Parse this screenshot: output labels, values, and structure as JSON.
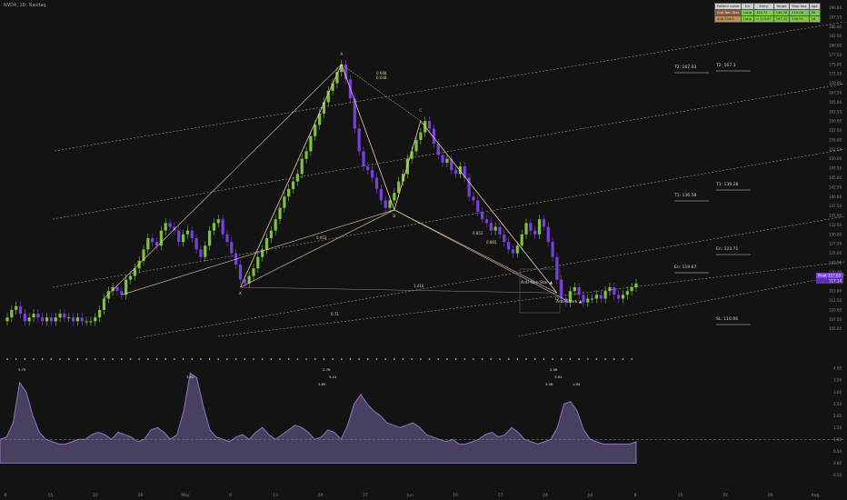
{
  "ticker": "NVDA, 1D, Nasdaq",
  "pattern_table": {
    "headers": [
      "Pattern name",
      "Dir",
      "Entry",
      "Target",
      "Stop loss",
      "Age"
    ],
    "rows": [
      {
        "name": "Anti-Nen Star",
        "dir": "Long",
        "entry": "123.71",
        "target": "139.28",
        "stop": "110.06",
        "age": "39"
      },
      {
        "name": "Anti-Shark",
        "dir": "Long",
        "entry": "< 119.67",
        "target": "167.31",
        "stop": "104.91",
        "age": "16"
      }
    ]
  },
  "price_badges": {
    "label": "Pivot",
    "value": "117.63",
    "current": "117.14"
  },
  "chart_data": {
    "type": "candlestick",
    "y_axis": {
      "min": 103.0,
      "max": 190.6
    },
    "y_ticks": [
      "190.00",
      "187.50",
      "185.00",
      "182.50",
      "180.00",
      "177.50",
      "175.00",
      "172.50",
      "170.00",
      "167.50",
      "165.00",
      "162.50",
      "160.00",
      "157.50",
      "155.00",
      "152.50",
      "150.00",
      "147.50",
      "145.00",
      "142.50",
      "140.00",
      "137.50",
      "135.00",
      "132.50",
      "130.00",
      "127.50",
      "125.00",
      "122.50",
      "120.00",
      "117.50",
      "115.00",
      "112.50",
      "110.00",
      "107.50",
      "105.00"
    ],
    "x_ticks": [
      "8",
      "15",
      "22",
      "29",
      "May",
      "6",
      "13",
      "20",
      "27",
      "Jun",
      "10",
      "17",
      "24",
      "Jul",
      "8",
      "15",
      "22",
      "29",
      "Aug",
      "5"
    ],
    "pattern_points": [
      {
        "label": "X",
        "price": 116.0
      },
      {
        "label": "A",
        "price": 175.0
      },
      {
        "label": "B",
        "price": 136.5
      },
      {
        "label": "C",
        "price": 160.0
      },
      {
        "label": "D",
        "price": 114.5
      }
    ],
    "ratio_labels": [
      "0.648",
      "0.648",
      "0.653",
      "0.852",
      "0.885",
      "1.416",
      "0.71"
    ],
    "pattern_names": [
      "Anti-Nen Star",
      "Anti-Shark"
    ],
    "levels": [
      {
        "label": "T2: 167.03",
        "value": 167.03
      },
      {
        "label": "T2: 167.3",
        "value": 167.3
      },
      {
        "label": "T1: 136.58",
        "value": 136.58
      },
      {
        "label": "T1: 139.28",
        "value": 139.28
      },
      {
        "label": "En: 123.71",
        "value": 123.71
      },
      {
        "label": "En: 119.67",
        "value": 119.67
      },
      {
        "label": "SL: 110.06",
        "value": 110.06
      }
    ],
    "candles_close": [
      108,
      110,
      111,
      109,
      107,
      108,
      109,
      108,
      107,
      108,
      107,
      108,
      109,
      108,
      108,
      107,
      108,
      107,
      107,
      107,
      108,
      110,
      113,
      115,
      116,
      115,
      114,
      118,
      119,
      121,
      123,
      126,
      129,
      128,
      127,
      131,
      133,
      132,
      131,
      128,
      130,
      131,
      129,
      126,
      124,
      127,
      131,
      133,
      134,
      130,
      128,
      125,
      122,
      118,
      117,
      119,
      121,
      124,
      126,
      129,
      131,
      134,
      137,
      140,
      142,
      144,
      146,
      150,
      152,
      156,
      159,
      162,
      165,
      168,
      170,
      173,
      175,
      171,
      166,
      158,
      152,
      148,
      147,
      145,
      142,
      139,
      137,
      139,
      141,
      144,
      146,
      150,
      152,
      155,
      157,
      160,
      158,
      154,
      151,
      149,
      150,
      147,
      146,
      148,
      145,
      140,
      139,
      136,
      134,
      133,
      131,
      132,
      130,
      128,
      126,
      125,
      127,
      130,
      133,
      131,
      130,
      134,
      132,
      128,
      124,
      118,
      113,
      112,
      115,
      116,
      114,
      112,
      113,
      113,
      114,
      113,
      115,
      116,
      114,
      113,
      114,
      115,
      116,
      117
    ],
    "oscillator": {
      "y_ticks": [
        "4.00",
        "3.50",
        "3.00",
        "2.50",
        "2.00",
        "1.50",
        "1.00",
        "0.50",
        "0.00",
        "-0.50"
      ],
      "peak_labels": [
        "3.75",
        "3.00",
        "3.65",
        "2.76",
        "3.01",
        "3.56",
        "2.56",
        "3.81",
        "1.94"
      ],
      "reference_level": 1.0,
      "values": [
        1.0,
        1.1,
        1.7,
        3.4,
        3.0,
        2.0,
        1.3,
        1.0,
        0.9,
        0.8,
        0.8,
        0.9,
        1.0,
        1.0,
        1.2,
        1.3,
        1.2,
        1.0,
        1.3,
        1.2,
        1.1,
        0.9,
        1.0,
        1.4,
        1.5,
        1.3,
        1.0,
        1.2,
        2.2,
        3.8,
        3.6,
        2.4,
        1.4,
        1.1,
        1.0,
        0.9,
        1.1,
        1.2,
        1.0,
        1.3,
        1.5,
        1.2,
        1.0,
        1.2,
        1.4,
        1.6,
        1.5,
        1.3,
        1.0,
        1.1,
        1.4,
        1.3,
        1.0,
        1.6,
        2.5,
        2.9,
        2.5,
        2.2,
        2.0,
        1.7,
        1.6,
        1.5,
        1.6,
        1.7,
        1.5,
        1.2,
        1.1,
        1.0,
        0.9,
        1.0,
        0.8,
        0.8,
        0.9,
        1.0,
        1.2,
        1.3,
        1.1,
        1.2,
        1.5,
        1.3,
        1.0,
        0.9,
        0.8,
        0.9,
        1.0,
        1.5,
        2.5,
        2.6,
        2.2,
        1.4,
        1.0,
        0.9,
        0.8,
        0.8,
        0.8,
        0.8,
        0.8,
        0.9
      ]
    }
  },
  "colors": {
    "bg": "#131313",
    "bull": "#7fc242",
    "bear": "#7a3fe0",
    "pattern": "#e7cda6",
    "channel": "#c8c8c8",
    "osc": "#8a75c0",
    "stop": "#d9d9d9"
  }
}
